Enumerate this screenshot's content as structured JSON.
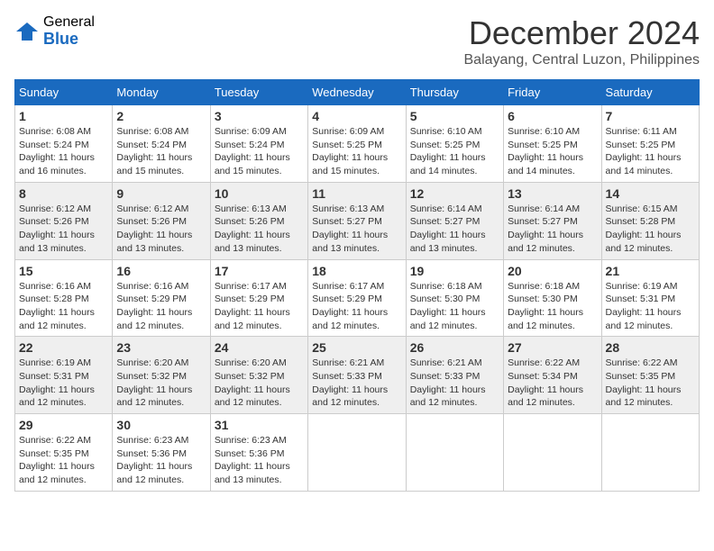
{
  "logo": {
    "general": "General",
    "blue": "Blue"
  },
  "title": {
    "month": "December 2024",
    "location": "Balayang, Central Luzon, Philippines"
  },
  "weekdays": [
    "Sunday",
    "Monday",
    "Tuesday",
    "Wednesday",
    "Thursday",
    "Friday",
    "Saturday"
  ],
  "weeks": [
    [
      {
        "day": "1",
        "sunrise": "6:08 AM",
        "sunset": "5:24 PM",
        "daylight": "11 hours and 16 minutes."
      },
      {
        "day": "2",
        "sunrise": "6:08 AM",
        "sunset": "5:24 PM",
        "daylight": "11 hours and 15 minutes."
      },
      {
        "day": "3",
        "sunrise": "6:09 AM",
        "sunset": "5:24 PM",
        "daylight": "11 hours and 15 minutes."
      },
      {
        "day": "4",
        "sunrise": "6:09 AM",
        "sunset": "5:25 PM",
        "daylight": "11 hours and 15 minutes."
      },
      {
        "day": "5",
        "sunrise": "6:10 AM",
        "sunset": "5:25 PM",
        "daylight": "11 hours and 14 minutes."
      },
      {
        "day": "6",
        "sunrise": "6:10 AM",
        "sunset": "5:25 PM",
        "daylight": "11 hours and 14 minutes."
      },
      {
        "day": "7",
        "sunrise": "6:11 AM",
        "sunset": "5:25 PM",
        "daylight": "11 hours and 14 minutes."
      }
    ],
    [
      {
        "day": "8",
        "sunrise": "6:12 AM",
        "sunset": "5:26 PM",
        "daylight": "11 hours and 13 minutes."
      },
      {
        "day": "9",
        "sunrise": "6:12 AM",
        "sunset": "5:26 PM",
        "daylight": "11 hours and 13 minutes."
      },
      {
        "day": "10",
        "sunrise": "6:13 AM",
        "sunset": "5:26 PM",
        "daylight": "11 hours and 13 minutes."
      },
      {
        "day": "11",
        "sunrise": "6:13 AM",
        "sunset": "5:27 PM",
        "daylight": "11 hours and 13 minutes."
      },
      {
        "day": "12",
        "sunrise": "6:14 AM",
        "sunset": "5:27 PM",
        "daylight": "11 hours and 13 minutes."
      },
      {
        "day": "13",
        "sunrise": "6:14 AM",
        "sunset": "5:27 PM",
        "daylight": "11 hours and 12 minutes."
      },
      {
        "day": "14",
        "sunrise": "6:15 AM",
        "sunset": "5:28 PM",
        "daylight": "11 hours and 12 minutes."
      }
    ],
    [
      {
        "day": "15",
        "sunrise": "6:16 AM",
        "sunset": "5:28 PM",
        "daylight": "11 hours and 12 minutes."
      },
      {
        "day": "16",
        "sunrise": "6:16 AM",
        "sunset": "5:29 PM",
        "daylight": "11 hours and 12 minutes."
      },
      {
        "day": "17",
        "sunrise": "6:17 AM",
        "sunset": "5:29 PM",
        "daylight": "11 hours and 12 minutes."
      },
      {
        "day": "18",
        "sunrise": "6:17 AM",
        "sunset": "5:29 PM",
        "daylight": "11 hours and 12 minutes."
      },
      {
        "day": "19",
        "sunrise": "6:18 AM",
        "sunset": "5:30 PM",
        "daylight": "11 hours and 12 minutes."
      },
      {
        "day": "20",
        "sunrise": "6:18 AM",
        "sunset": "5:30 PM",
        "daylight": "11 hours and 12 minutes."
      },
      {
        "day": "21",
        "sunrise": "6:19 AM",
        "sunset": "5:31 PM",
        "daylight": "11 hours and 12 minutes."
      }
    ],
    [
      {
        "day": "22",
        "sunrise": "6:19 AM",
        "sunset": "5:31 PM",
        "daylight": "11 hours and 12 minutes."
      },
      {
        "day": "23",
        "sunrise": "6:20 AM",
        "sunset": "5:32 PM",
        "daylight": "11 hours and 12 minutes."
      },
      {
        "day": "24",
        "sunrise": "6:20 AM",
        "sunset": "5:32 PM",
        "daylight": "11 hours and 12 minutes."
      },
      {
        "day": "25",
        "sunrise": "6:21 AM",
        "sunset": "5:33 PM",
        "daylight": "11 hours and 12 minutes."
      },
      {
        "day": "26",
        "sunrise": "6:21 AM",
        "sunset": "5:33 PM",
        "daylight": "11 hours and 12 minutes."
      },
      {
        "day": "27",
        "sunrise": "6:22 AM",
        "sunset": "5:34 PM",
        "daylight": "11 hours and 12 minutes."
      },
      {
        "day": "28",
        "sunrise": "6:22 AM",
        "sunset": "5:35 PM",
        "daylight": "11 hours and 12 minutes."
      }
    ],
    [
      {
        "day": "29",
        "sunrise": "6:22 AM",
        "sunset": "5:35 PM",
        "daylight": "11 hours and 12 minutes."
      },
      {
        "day": "30",
        "sunrise": "6:23 AM",
        "sunset": "5:36 PM",
        "daylight": "11 hours and 12 minutes."
      },
      {
        "day": "31",
        "sunrise": "6:23 AM",
        "sunset": "5:36 PM",
        "daylight": "11 hours and 13 minutes."
      },
      null,
      null,
      null,
      null
    ]
  ]
}
